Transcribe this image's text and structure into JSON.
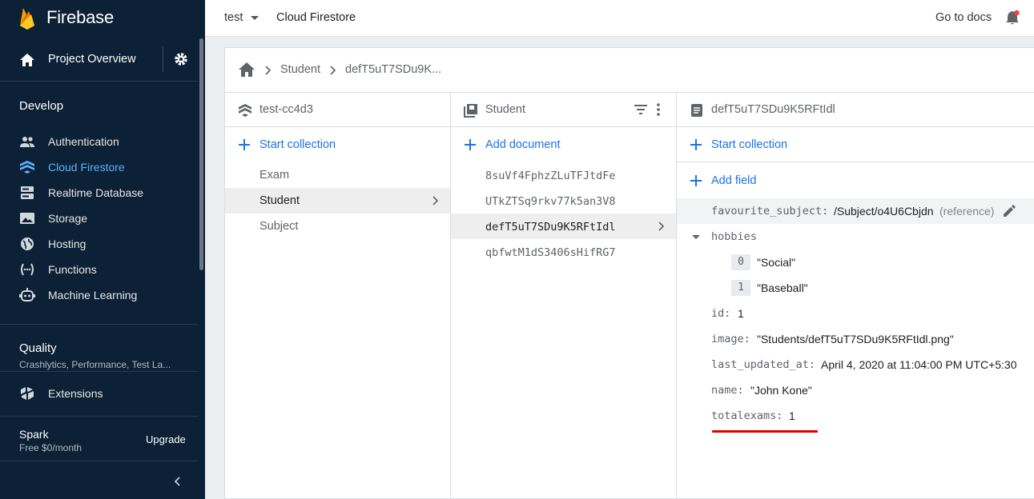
{
  "app": {
    "brand": "Firebase"
  },
  "sidebar": {
    "overview_label": "Project Overview",
    "develop_title": "Develop",
    "develop_items": [
      {
        "label": "Authentication",
        "icon": "people-icon"
      },
      {
        "label": "Cloud Firestore",
        "icon": "firestore-icon",
        "active": true
      },
      {
        "label": "Realtime Database",
        "icon": "database-icon"
      },
      {
        "label": "Storage",
        "icon": "image-icon"
      },
      {
        "label": "Hosting",
        "icon": "globe-icon"
      },
      {
        "label": "Functions",
        "icon": "functions-icon"
      },
      {
        "label": "Machine Learning",
        "icon": "robot-icon"
      }
    ],
    "quality_title": "Quality",
    "quality_subtitle": "Crashlytics, Performance, Test La...",
    "extensions_label": "Extensions",
    "plan_name": "Spark",
    "plan_price": "Free $0/month",
    "upgrade_label": "Upgrade"
  },
  "topbar": {
    "project": "test",
    "title": "Cloud Firestore",
    "docs_link": "Go to docs"
  },
  "breadcrumb": {
    "items": [
      "Student",
      "defT5uT7SDu9K..."
    ]
  },
  "columns": {
    "root": {
      "header": "test-cc4d3",
      "add_label": "Start collection",
      "items": [
        "Exam",
        "Student",
        "Subject"
      ]
    },
    "collection": {
      "header": "Student",
      "add_label": "Add document",
      "items": [
        "8suVf4FphzZLuTFJtdFe",
        "UTkZTSq9rkv77k5an3V8",
        "defT5uT7SDu9K5RFtIdl",
        "qbfwtM1dS3406sHifRG7"
      ]
    },
    "document": {
      "header": "defT5uT7SDu9K5RFtIdl",
      "add_collection_label": "Start collection",
      "add_field_label": "Add field",
      "fields": {
        "favourite_subject": {
          "key": "favourite_subject:",
          "value": "/Subject/o4U6Cbjdn",
          "type": "(reference)"
        },
        "hobbies": {
          "key": "hobbies",
          "items": [
            {
              "index": "0",
              "value": "\"Social\""
            },
            {
              "index": "1",
              "value": "\"Baseball\""
            }
          ]
        },
        "id": {
          "key": "id:",
          "value": "1"
        },
        "image": {
          "key": "image:",
          "value": "\"Students/defT5uT7SDu9K5RFtIdl.png\""
        },
        "last_updated_at": {
          "key": "last_updated_at:",
          "value": "April 4, 2020 at 11:04:00 PM UTC+5:30"
        },
        "name": {
          "key": "name:",
          "value": "\"John Kone\""
        },
        "totalexams": {
          "key": "totalexams:",
          "value": "1"
        }
      }
    }
  },
  "colors": {
    "accent": "#1a73e8",
    "sidebar_bg": "#0c2135",
    "active_nav": "#5eb0ff",
    "highlight_underline": "#e00000",
    "notification_dot": "#f44336"
  }
}
